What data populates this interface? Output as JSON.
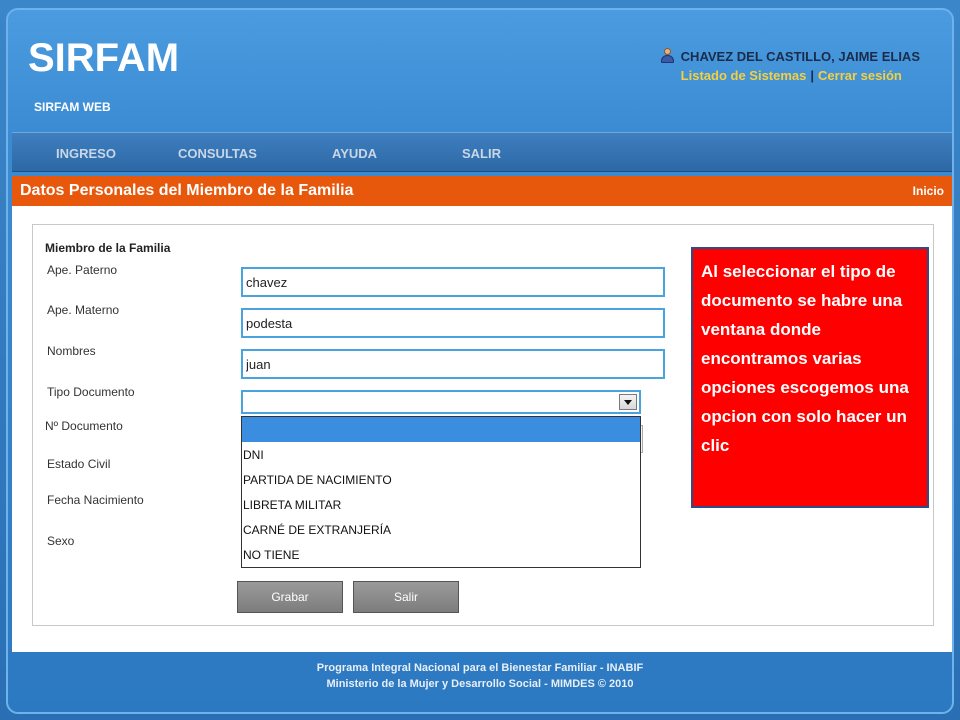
{
  "app": {
    "logo": "SIRFAM",
    "subtitle": "SIRFAM WEB"
  },
  "user": {
    "name": "CHAVEZ DEL CASTILLO, JAIME ELIAS",
    "systems_link": "Listado de Sistemas",
    "separator": "|",
    "logout_link": "Cerrar sesión",
    "icon": "user-icon"
  },
  "menu": {
    "items": [
      {
        "label": "INGRESO"
      },
      {
        "label": "CONSULTAS"
      },
      {
        "label": "AYUDA"
      },
      {
        "label": "SALIR"
      }
    ]
  },
  "titlebar": {
    "title": "Datos Personales del Miembro de la Familia",
    "home_link": "Inicio"
  },
  "form": {
    "section_title": "Miembro de la Familia",
    "labels": {
      "paterno": "Ape. Paterno",
      "materno": "Ape. Materno",
      "nombres": "Nombres",
      "tipo_doc": "Tipo Documento",
      "num_doc": "Nº Documento",
      "estado_civil": "Estado Civil",
      "fecha_nac": "Fecha Nacimiento",
      "sexo": "Sexo"
    },
    "values": {
      "paterno": "chavez",
      "materno": "podesta",
      "nombres": "juan",
      "tipo_doc": ""
    },
    "tipo_doc_options": [
      "",
      "DNI",
      "PARTIDA DE NACIMIENTO",
      "LIBRETA MILITAR",
      "CARNÉ DE EXTRANJERÍA",
      "NO TIENE"
    ],
    "buttons": {
      "save": "Grabar",
      "exit": "Salir"
    }
  },
  "callout": {
    "text": "Al seleccionar el tipo de documento se habre una ventana donde encontramos varias opciones escogemos una opcion con solo hacer un clic"
  },
  "footer": {
    "line1": "Programa Integral Nacional para el Bienestar Familiar - INABIF",
    "line2": "Ministerio de la Mujer y Desarrollo Social - MIMDES © 2010"
  },
  "colors": {
    "background": "#2c79c2",
    "title_bar": "#e8580c",
    "link": "#f4d03f",
    "callout": "#ff0000",
    "field_border": "#4aa3df"
  }
}
